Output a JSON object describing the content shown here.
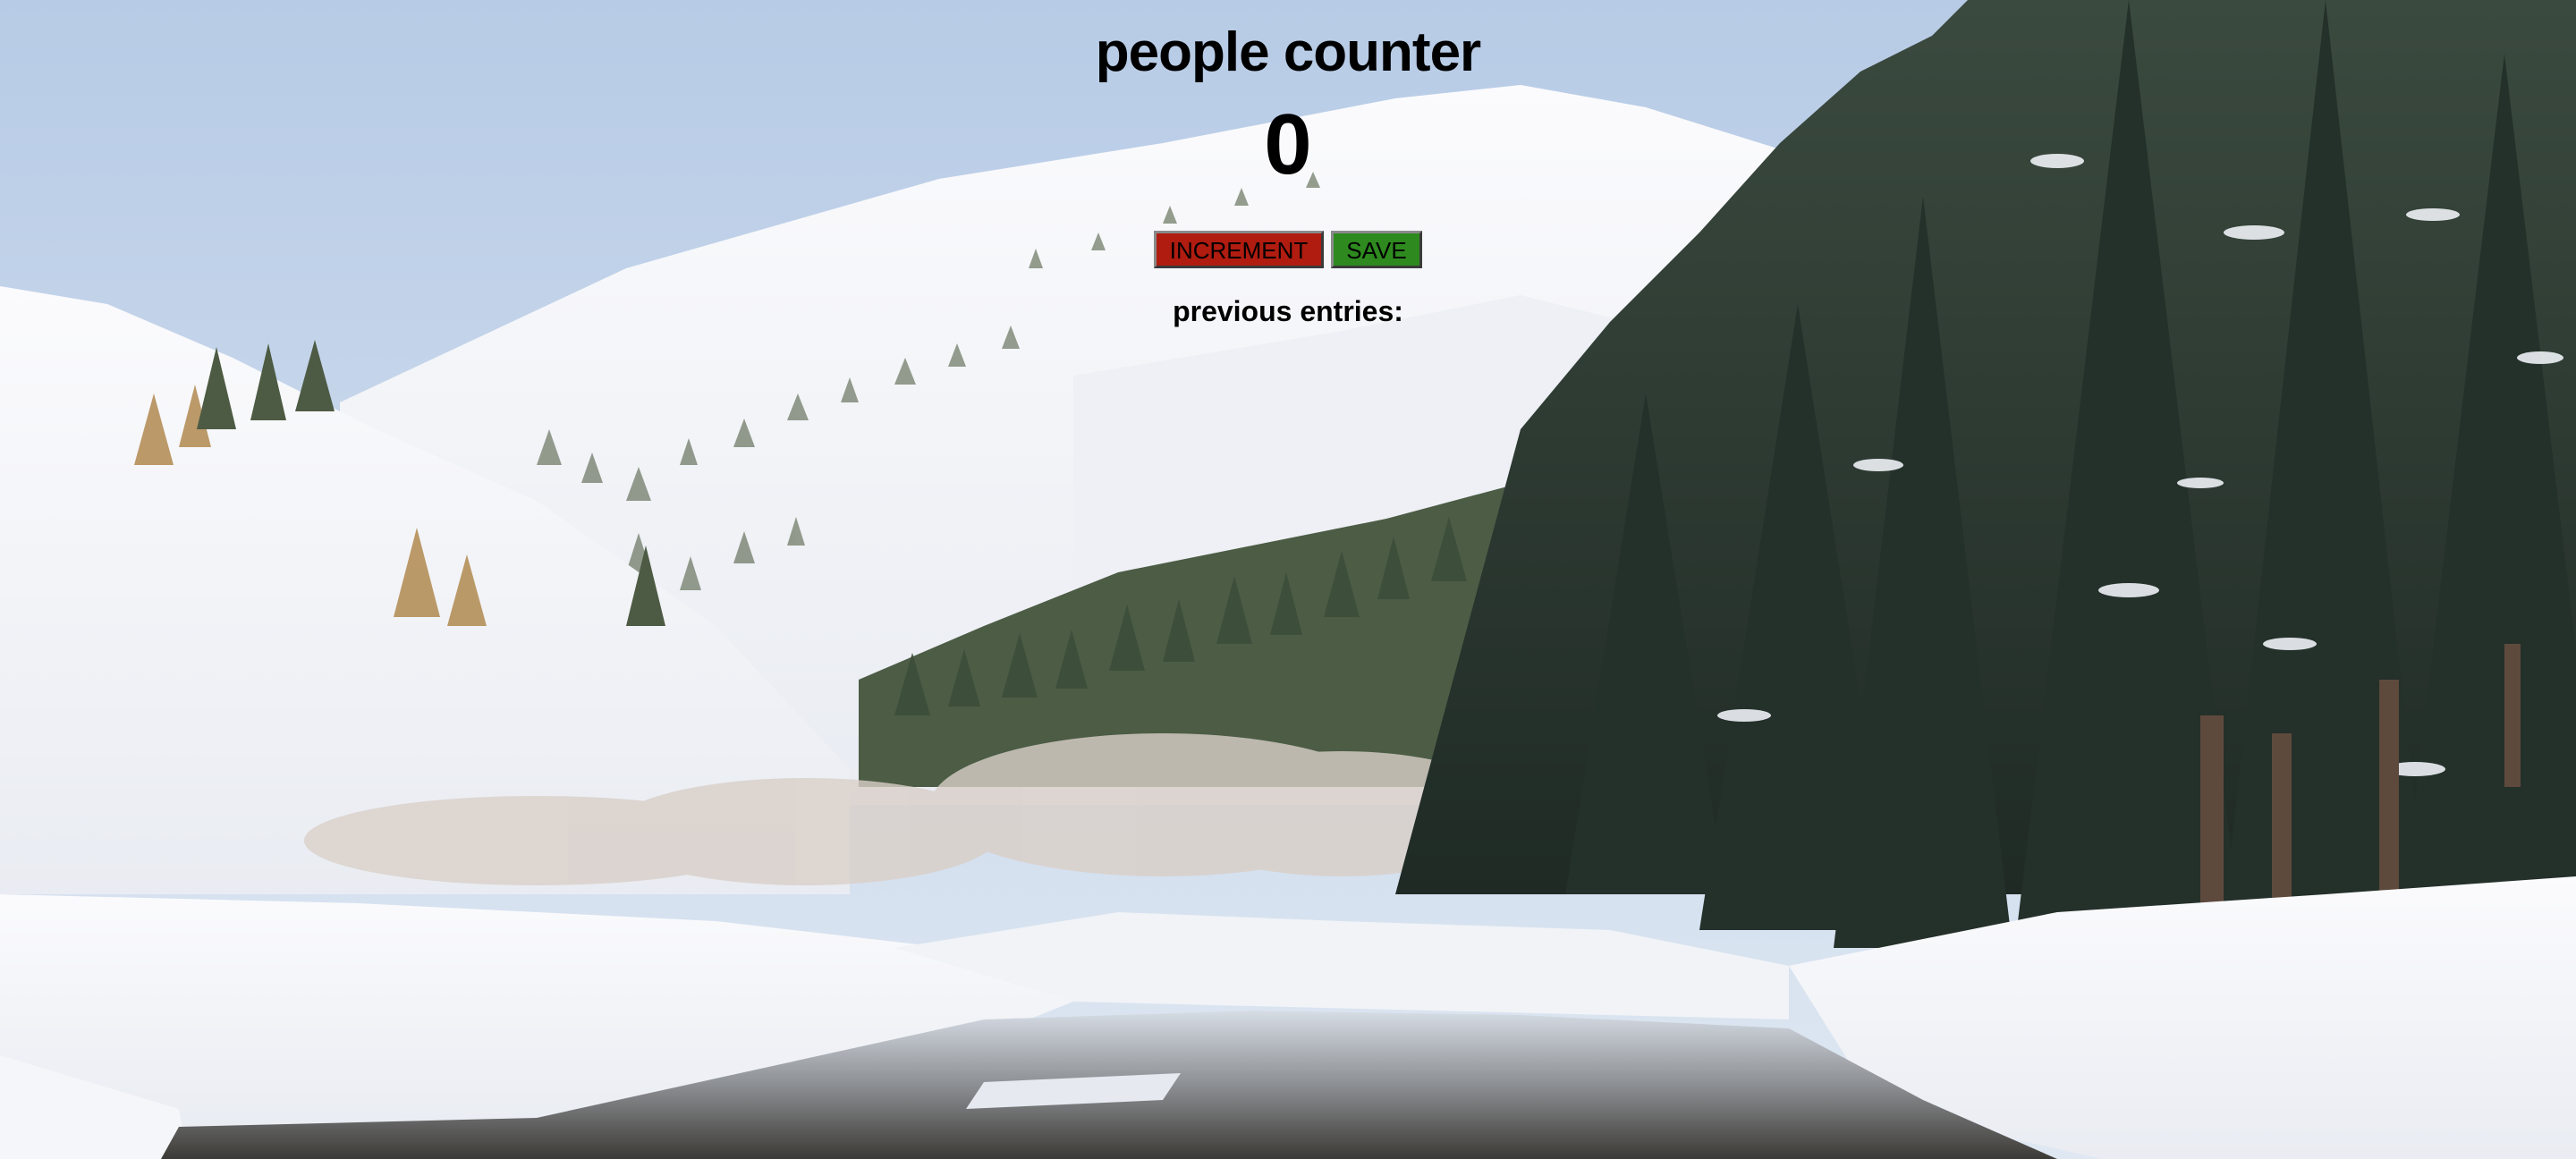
{
  "app": {
    "title": "people counter",
    "count": "0",
    "buttons": {
      "increment_label": "INCREMENT",
      "save_label": "SAVE"
    },
    "entries_label": "previous entries:",
    "entries": []
  },
  "colors": {
    "increment_button": "#b01c10",
    "save_button": "#2e8a1f",
    "text": "#000000"
  }
}
